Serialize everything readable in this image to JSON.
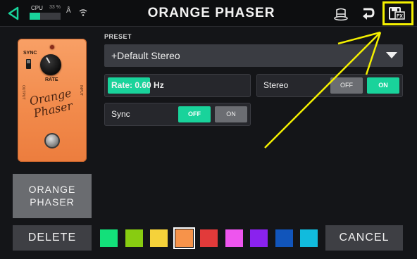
{
  "header": {
    "title": "ORANGE PHASER",
    "cpu_label": "CPU",
    "cpu_percent_text": "33 %",
    "cpu_fraction": 0.33,
    "icons": [
      "back-icon",
      "bluetooth-icon",
      "wifi-icon",
      "hat-icon",
      "undo-icon",
      "save-fx-icon"
    ],
    "accent_color": "#19d39b"
  },
  "pedal": {
    "sync_label": "SYNC",
    "rate_label": "RATE",
    "output_label": "OUTPUT",
    "input_label": "INPUT",
    "script_line1": "Orange",
    "script_line2": "Phaser"
  },
  "preset": {
    "label": "PRESET",
    "value": "+Default Stereo"
  },
  "params": {
    "rate": {
      "text": "Rate: 0.60 Hz",
      "fraction": 0.3
    },
    "stereo": {
      "label": "Stereo",
      "off": "OFF",
      "on": "ON",
      "selected": "ON"
    },
    "sync": {
      "label": "Sync",
      "off": "OFF",
      "on": "ON",
      "selected": "OFF"
    }
  },
  "model_button": {
    "line1": "ORANGE",
    "line2": "PHASER"
  },
  "footer": {
    "delete_label": "DELETE",
    "cancel_label": "CANCEL",
    "swatches": [
      "#13e07a",
      "#88cc11",
      "#f5d23a",
      "#f7934a",
      "#e23a3a",
      "#ee55ee",
      "#8a22ee",
      "#1155bb",
      "#11bbdd"
    ],
    "selected_swatch": 3
  },
  "annotation_color": "#f4f000"
}
